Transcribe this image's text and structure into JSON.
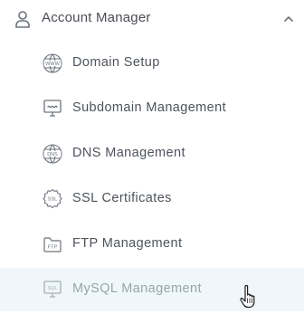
{
  "header": {
    "title": "Account Manager",
    "icon": "user-icon",
    "expanded": true,
    "chevron_icon": "chevron-up-icon"
  },
  "items": [
    {
      "label": "Domain Setup",
      "icon": "www-globe-icon",
      "icon_text": "WWW"
    },
    {
      "label": "Subdomain Management",
      "icon": "monitor-icon"
    },
    {
      "label": "DNS Management",
      "icon": "dns-globe-icon",
      "icon_text": "DNS"
    },
    {
      "label": "SSL Certificates",
      "icon": "ssl-badge-icon",
      "icon_text": "SSL"
    },
    {
      "label": "FTP Management",
      "icon": "ftp-folder-icon",
      "icon_text": "FTP"
    },
    {
      "label": "MySQL Management",
      "icon": "sql-monitor-icon",
      "icon_text": "SQL",
      "state": "hovered"
    }
  ],
  "colors": {
    "text": "#4e535c",
    "icon": "#6d737b",
    "hover_background": "#f0f7fb",
    "hover_text": "#9aa3ab"
  }
}
